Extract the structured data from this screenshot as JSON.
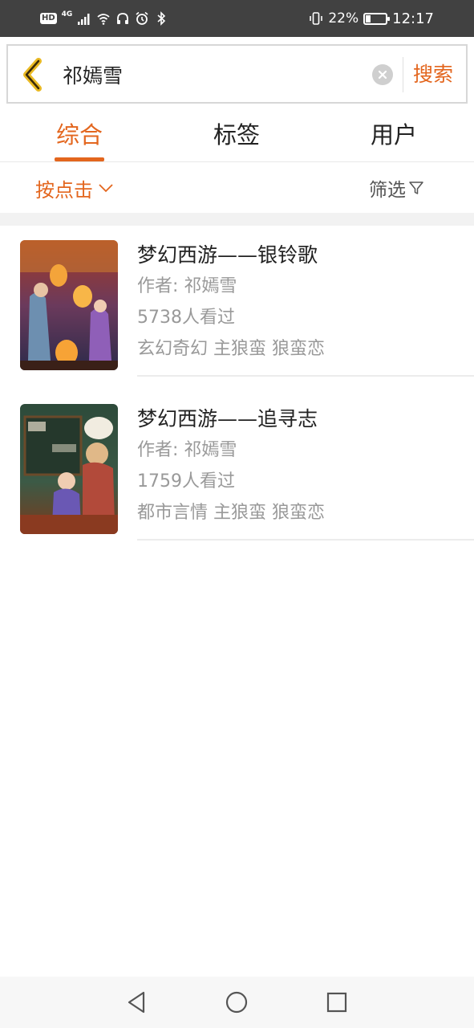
{
  "status_bar": {
    "hd_badge": "HD",
    "network": "4G",
    "battery_percent": "22%",
    "battery_level": 0.22,
    "time": "12:17",
    "icons": [
      "signal-icon",
      "wifi-icon",
      "headphones-icon",
      "alarm-icon",
      "bluetooth-icon",
      "vibrate-icon",
      "battery-icon"
    ]
  },
  "search": {
    "query": "祁嫣雪",
    "button_label": "搜索",
    "back_icon": "chevron-left-icon",
    "clear_icon": "clear-icon"
  },
  "tabs": [
    {
      "label": "综合",
      "active": true
    },
    {
      "label": "标签",
      "active": false
    },
    {
      "label": "用户",
      "active": false
    }
  ],
  "sort": {
    "label": "按点击",
    "icon": "chevron-down-icon"
  },
  "filter": {
    "label": "筛选",
    "icon": "funnel-icon"
  },
  "results": [
    {
      "title": "梦幻西游——银铃歌",
      "author": "作者: 祁嫣雪",
      "views": "5738人看过",
      "tags": "玄幻奇幻 主狼蛮 狼蛮恋"
    },
    {
      "title": "梦幻西游——追寻志",
      "author": "作者: 祁嫣雪",
      "views": "1759人看过",
      "tags": "都市言情 主狼蛮 狼蛮恋"
    }
  ],
  "colors": {
    "accent": "#e3661e",
    "status_bar": "#414141",
    "meta_text": "#999999"
  },
  "nav_bar": {
    "icons": [
      "back-triangle-icon",
      "home-circle-icon",
      "recents-square-icon"
    ]
  }
}
